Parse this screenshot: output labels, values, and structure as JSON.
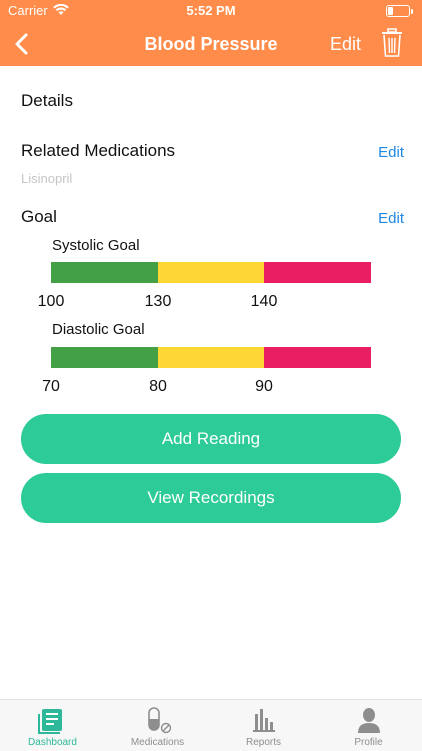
{
  "status_bar": {
    "carrier": "Carrier",
    "time": "5:52 PM"
  },
  "nav": {
    "title": "Blood Pressure",
    "edit_label": "Edit"
  },
  "details": {
    "title": "Details"
  },
  "related": {
    "title": "Related Medications",
    "edit_label": "Edit",
    "medication": "Lisinopril"
  },
  "goal": {
    "title": "Goal",
    "edit_label": "Edit",
    "systolic": {
      "label": "Systolic Goal",
      "ticks": [
        "100",
        "130",
        "140"
      ]
    },
    "diastolic": {
      "label": "Diastolic Goal",
      "ticks": [
        "70",
        "80",
        "90"
      ]
    },
    "colors": {
      "green": "#43A047",
      "yellow": "#FDD835",
      "red": "#E91E63"
    }
  },
  "buttons": {
    "add_reading": "Add Reading",
    "view_recordings": "View Recordings"
  },
  "tabs": [
    {
      "label": "Dashboard",
      "icon": "dashboard-icon",
      "active": true
    },
    {
      "label": "Medications",
      "icon": "medications-icon",
      "active": false
    },
    {
      "label": "Reports",
      "icon": "reports-icon",
      "active": false
    },
    {
      "label": "Profile",
      "icon": "profile-icon",
      "active": false
    }
  ],
  "colors": {
    "header": "#FF8C4A",
    "accent_button": "#2DCB97",
    "link": "#1E88E5",
    "tab_active": "#2DB89A"
  }
}
